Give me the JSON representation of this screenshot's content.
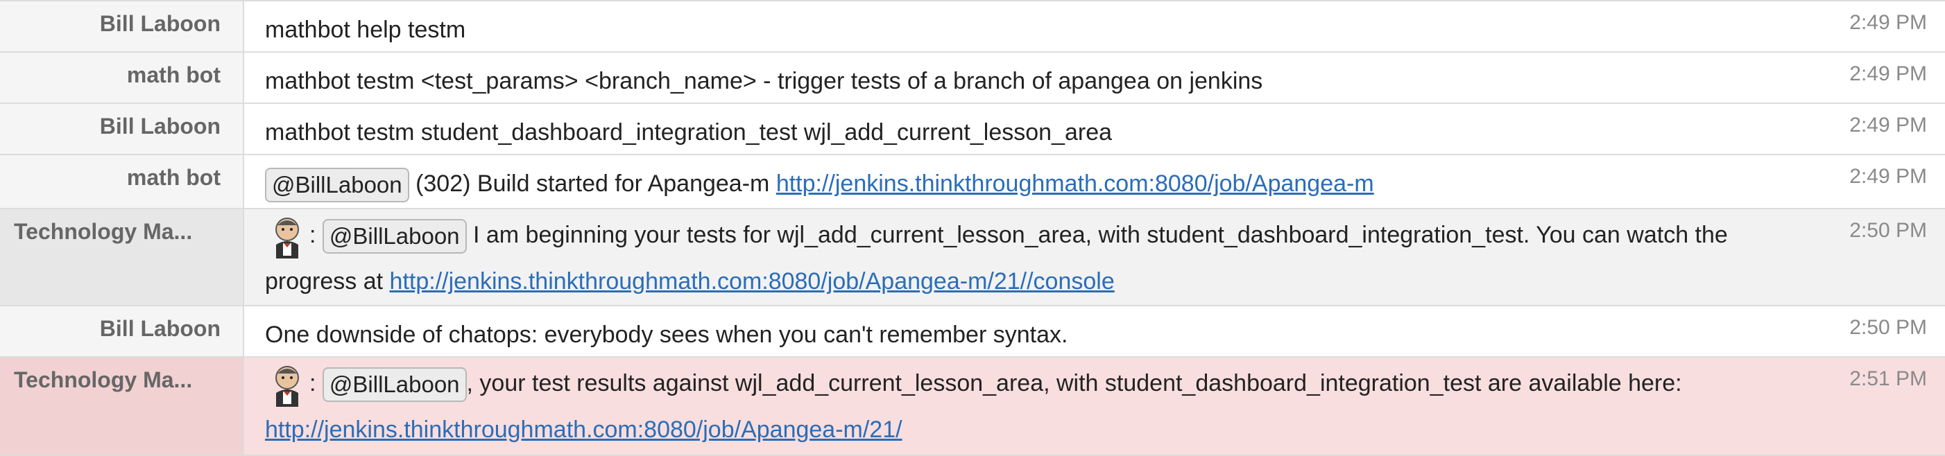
{
  "messages": [
    {
      "sender": "Bill Laboon",
      "text": "mathbot help testm",
      "time": "2:49 PM"
    },
    {
      "sender": "math bot",
      "text": "mathbot testm <test_params> <branch_name> - trigger tests of a branch of apangea on jenkins",
      "time": "2:49 PM"
    },
    {
      "sender": "Bill Laboon",
      "text": "mathbot testm student_dashboard_integration_test wjl_add_current_lesson_area",
      "time": "2:49 PM"
    },
    {
      "sender": "math bot",
      "mention": "@BillLaboon",
      "text": " (302) Build started for Apangea-m ",
      "link": "http://jenkins.thinkthroughmath.com:8080/job/Apangea-m",
      "time": "2:49 PM"
    },
    {
      "sender": "Technology Ma...",
      "mention": "@BillLaboon",
      "text": " I am beginning your tests for wjl_add_current_lesson_area, with student_dashboard_integration_test. You can watch the progress at ",
      "link": "http://jenkins.thinkthroughmath.com:8080/job/Apangea-m/21//console",
      "time": "2:50 PM"
    },
    {
      "sender": "Bill Laboon",
      "text": "One downside of chatops: everybody sees when you can't remember syntax.",
      "time": "2:50 PM"
    },
    {
      "sender": "Technology Ma...",
      "mention": "@BillLaboon",
      "text": ", your test results against wjl_add_current_lesson_area, with student_dashboard_integration_test are available here: ",
      "link": "http://jenkins.thinkthroughmath.com:8080/job/Apangea-m/21/",
      "time": "2:51 PM"
    }
  ],
  "avatar_icon": "jenkins-butler-icon",
  "colon": ":"
}
